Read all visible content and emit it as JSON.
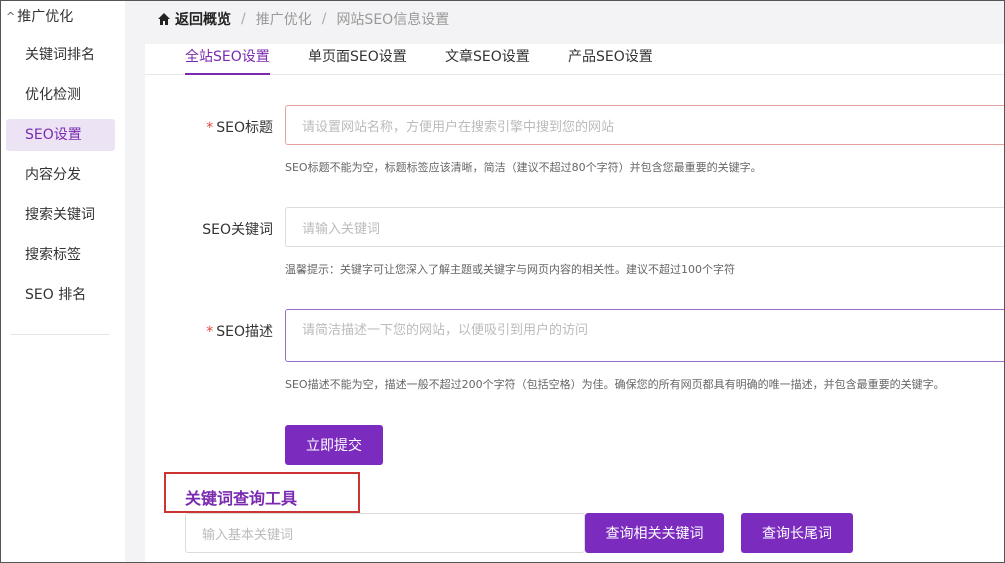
{
  "sidebar": {
    "group_label": "推广优化",
    "items": [
      {
        "label": "关键词排名",
        "active": false
      },
      {
        "label": "优化检测",
        "active": false
      },
      {
        "label": "SEO设置",
        "active": true
      },
      {
        "label": "内容分发",
        "active": false
      },
      {
        "label": "搜索关键词",
        "active": false
      },
      {
        "label": "搜索标签",
        "active": false
      },
      {
        "label": "SEO 排名",
        "active": false
      }
    ]
  },
  "breadcrumb": {
    "home": "返回概览",
    "items": [
      "推广优化",
      "网站SEO信息设置"
    ],
    "separator": "/"
  },
  "tabs": [
    {
      "label": "全站SEO设置",
      "active": true
    },
    {
      "label": "单页面SEO设置",
      "active": false
    },
    {
      "label": "文章SEO设置",
      "active": false
    },
    {
      "label": "产品SEO设置",
      "active": false
    }
  ],
  "form": {
    "required_mark": "*",
    "seo_title": {
      "label": "SEO标题",
      "placeholder": "请设置网站名称，方便用户在搜索引擎中搜到您的网站",
      "hint": "SEO标题不能为空，标题标签应该清晰，简洁（建议不超过80个字符）并包含您最重要的关键字。"
    },
    "seo_keywords": {
      "label": "SEO关键词",
      "placeholder": "请输入关键词",
      "hint": "温馨提示：关键字可让您深入了解主题或关键字与网页内容的相关性。建议不超过100个字符"
    },
    "seo_description": {
      "label": "SEO描述",
      "placeholder": "请简洁描述一下您的网站，以便吸引到用户的访问",
      "hint": "SEO描述不能为空，描述一般不超过200个字符（包括空格）为佳。确保您的所有网页都具有明确的唯一描述，并包含最重要的关键字。"
    },
    "submit_label": "立即提交"
  },
  "keyword_tool": {
    "title": "关键词查询工具",
    "placeholder": "输入基本关键词",
    "related_button": "查询相关关键词",
    "longtail_button": "查询长尾词"
  },
  "colors": {
    "accent": "#7b2cbf",
    "active_bg": "#ece4f5",
    "required": "#e0483e",
    "highlight_box": "#cc3333"
  }
}
